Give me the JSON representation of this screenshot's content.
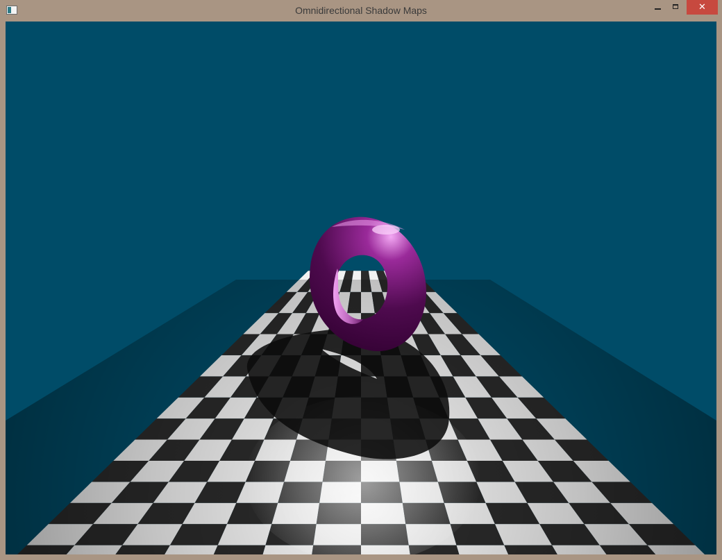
{
  "window": {
    "title": "Omnidirectional Shadow Maps",
    "app_icon": "window-app-icon",
    "controls": {
      "minimize_icon": "minimize-icon",
      "maximize_icon": "maximize-icon",
      "close_glyph": "✕"
    }
  },
  "scene": {
    "background_color": "#004c68",
    "floor": {
      "light_tile": "#f2f2f2",
      "dark_tile": "#2b2b2b"
    },
    "torus_color": "#5a0c5a",
    "torus_highlight": "#f0a0f0",
    "shadow_color": "#0a0a0a"
  }
}
